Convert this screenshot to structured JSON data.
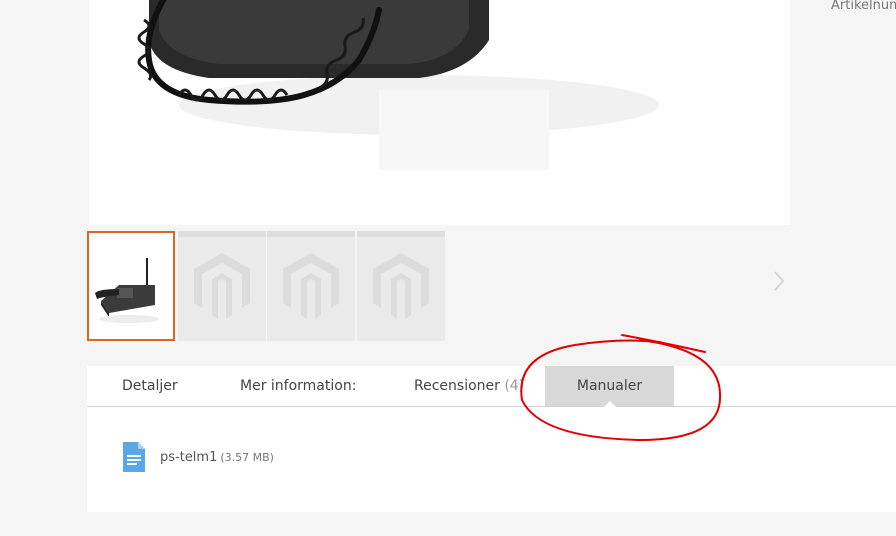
{
  "header": {
    "sku_label_partial": "Artikelnum"
  },
  "gallery": {
    "main_image_alt": "",
    "thumbnails": [
      {
        "kind": "product-photo",
        "active": true
      },
      {
        "kind": "magento-placeholder",
        "active": false
      },
      {
        "kind": "magento-placeholder",
        "active": false
      },
      {
        "kind": "magento-placeholder",
        "active": false
      }
    ],
    "next_icon": "chevron-right-icon"
  },
  "tabs": {
    "items": [
      {
        "label": "Detaljer",
        "count": ""
      },
      {
        "label": "Mer information:",
        "count": ""
      },
      {
        "label": "Recensioner",
        "count": "(4)"
      },
      {
        "label": "Manualer",
        "count": ""
      }
    ],
    "active": "Manualer"
  },
  "manuals": {
    "files": [
      {
        "name": "ps-telm1",
        "size": "(3.57 MB)",
        "icon": "document-icon"
      }
    ]
  },
  "colors": {
    "accent": "#e0631f",
    "annotation": "#e00000",
    "active_tab_bg": "#d8d8d8"
  }
}
